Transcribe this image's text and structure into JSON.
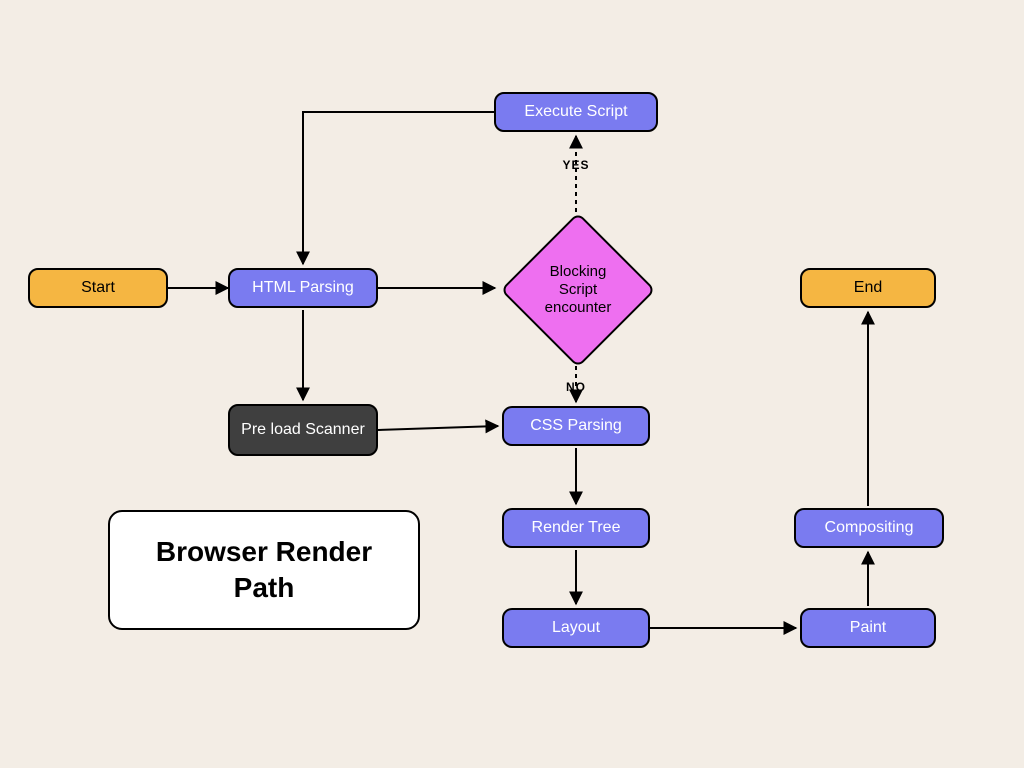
{
  "title": "Browser Render Path",
  "nodes": {
    "start": {
      "label": "Start"
    },
    "html_parsing": {
      "label": "HTML Parsing"
    },
    "exec_script": {
      "label": "Execute Script"
    },
    "decision": {
      "label": "Blocking Script encounter"
    },
    "preload": {
      "label": "Pre load Scanner"
    },
    "css_parsing": {
      "label": "CSS Parsing"
    },
    "render_tree": {
      "label": "Render Tree"
    },
    "layout": {
      "label": "Layout"
    },
    "paint": {
      "label": "Paint"
    },
    "compositing": {
      "label": "Compositing"
    },
    "end": {
      "label": "End"
    }
  },
  "branch_labels": {
    "yes": "YES",
    "no": "NO"
  },
  "edges": [
    {
      "from": "start",
      "to": "html_parsing"
    },
    {
      "from": "html_parsing",
      "to": "decision"
    },
    {
      "from": "decision",
      "to": "exec_script",
      "label": "YES"
    },
    {
      "from": "exec_script",
      "to": "html_parsing"
    },
    {
      "from": "decision",
      "to": "css_parsing",
      "label": "NO"
    },
    {
      "from": "html_parsing",
      "to": "preload"
    },
    {
      "from": "preload",
      "to": "css_parsing"
    },
    {
      "from": "css_parsing",
      "to": "render_tree"
    },
    {
      "from": "render_tree",
      "to": "layout"
    },
    {
      "from": "layout",
      "to": "paint"
    },
    {
      "from": "paint",
      "to": "compositing"
    },
    {
      "from": "compositing",
      "to": "end"
    }
  ]
}
